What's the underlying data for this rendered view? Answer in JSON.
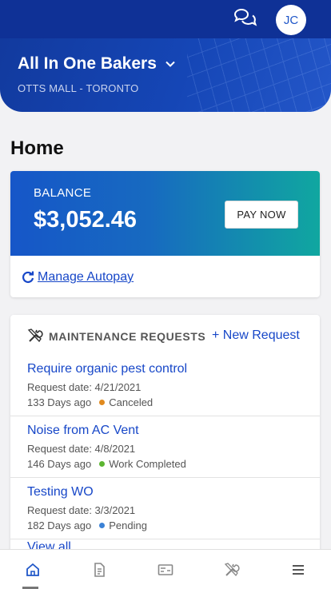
{
  "header": {
    "avatar_initials": "JC",
    "property_name": "All In One Bakers",
    "property_location": "OTTS MALL - TORONTO"
  },
  "page": {
    "title": "Home"
  },
  "balance": {
    "label": "BALANCE",
    "amount": "$3,052.46",
    "pay_button": "PAY NOW",
    "autopay_link": "Manage Autopay"
  },
  "maintenance": {
    "title": "MAINTENANCE REQUESTS",
    "new_request": "+ New Request",
    "requests": [
      {
        "title": "Require organic pest control",
        "date": "Request date: 4/21/2021",
        "age": "133 Days ago",
        "status": "Canceled",
        "status_color": "#e08a1e"
      },
      {
        "title": "Noise from AC Vent",
        "date": "Request date: 4/8/2021",
        "age": "146 Days ago",
        "status": "Work Completed",
        "status_color": "#5cb531"
      },
      {
        "title": "Testing WO",
        "date": "Request date: 3/3/2021",
        "age": "182 Days ago",
        "status": "Pending",
        "status_color": "#3b82d6"
      }
    ],
    "view_all": "View all"
  },
  "nav": {
    "items": [
      "home-icon",
      "document-icon",
      "billing-icon",
      "maintenance-icon",
      "menu-icon"
    ]
  },
  "colors": {
    "brand": "#0f3196",
    "link": "#1747c8"
  }
}
